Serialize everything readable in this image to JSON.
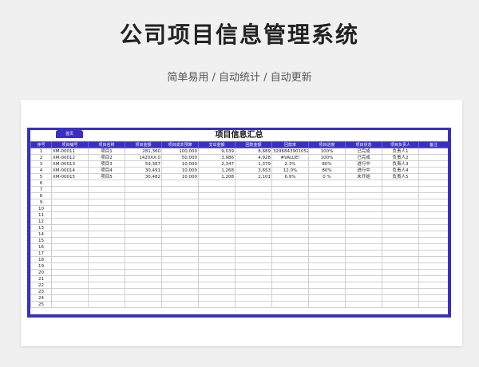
{
  "header": {
    "title": "公司项目信息管理系统",
    "subtitle": "简单易用 / 自动统计 / 自动更新"
  },
  "sheet": {
    "tab_label": "首页",
    "title": "项目信息汇总",
    "columns": [
      "序号",
      "项目编号",
      "项目名称",
      "项目金额",
      "项目成本预算",
      "支出金额",
      "回款金额",
      "回款率",
      "项目进度",
      "项目状态",
      "项目负责人",
      "备注"
    ],
    "rows": [
      {
        "no": "1",
        "code": "XM-00011",
        "name": "项目1",
        "amount": "281,360",
        "budget": "100,000",
        "expense": "9,039",
        "received": "8,689",
        "rate": "329684390105294%",
        "progress": "100%",
        "status": "已完成",
        "owner": "负责人1",
        "note": ""
      },
      {
        "no": "2",
        "code": "XM-00012",
        "name": "项目2",
        "amount": "1420XX.0",
        "budget": "50,000",
        "expense": "3,986",
        "received": "4,928",
        "rate": "#VALUE!",
        "progress": "100%",
        "status": "已完成",
        "owner": "负责人2",
        "note": ""
      },
      {
        "no": "3",
        "code": "XM-00013",
        "name": "项目3",
        "amount": "59,387",
        "budget": "10,000",
        "expense": "2,347",
        "received": "1,379",
        "rate": "2.3%",
        "progress": "80%",
        "status": "进行中",
        "owner": "负责人3",
        "note": ""
      },
      {
        "no": "4",
        "code": "XM-00014",
        "name": "项目4",
        "amount": "30,491",
        "budget": "10,000",
        "expense": "1,268",
        "received": "3,653",
        "rate": "12.0%",
        "progress": "80%",
        "status": "进行中",
        "owner": "负责人4",
        "note": ""
      },
      {
        "no": "5",
        "code": "XM-00015",
        "name": "项目5",
        "amount": "30,482",
        "budget": "10,000",
        "expense": "1,208",
        "received": "2,101",
        "rate": "6.9%",
        "progress": "0 %",
        "status": "未开始",
        "owner": "负责人5",
        "note": ""
      },
      {
        "no": "6"
      },
      {
        "no": "7"
      },
      {
        "no": "8"
      },
      {
        "no": "9"
      },
      {
        "no": "10"
      },
      {
        "no": "11"
      },
      {
        "no": "12"
      },
      {
        "no": "13"
      },
      {
        "no": "14"
      },
      {
        "no": "15"
      },
      {
        "no": "16"
      },
      {
        "no": "17"
      },
      {
        "no": "18"
      },
      {
        "no": "19"
      },
      {
        "no": "20"
      },
      {
        "no": "21"
      },
      {
        "no": "22"
      },
      {
        "no": "23"
      },
      {
        "no": "24"
      },
      {
        "no": "25"
      }
    ]
  },
  "colors": {
    "accent": "#3a2fc2",
    "background": "#f0f0f0"
  }
}
